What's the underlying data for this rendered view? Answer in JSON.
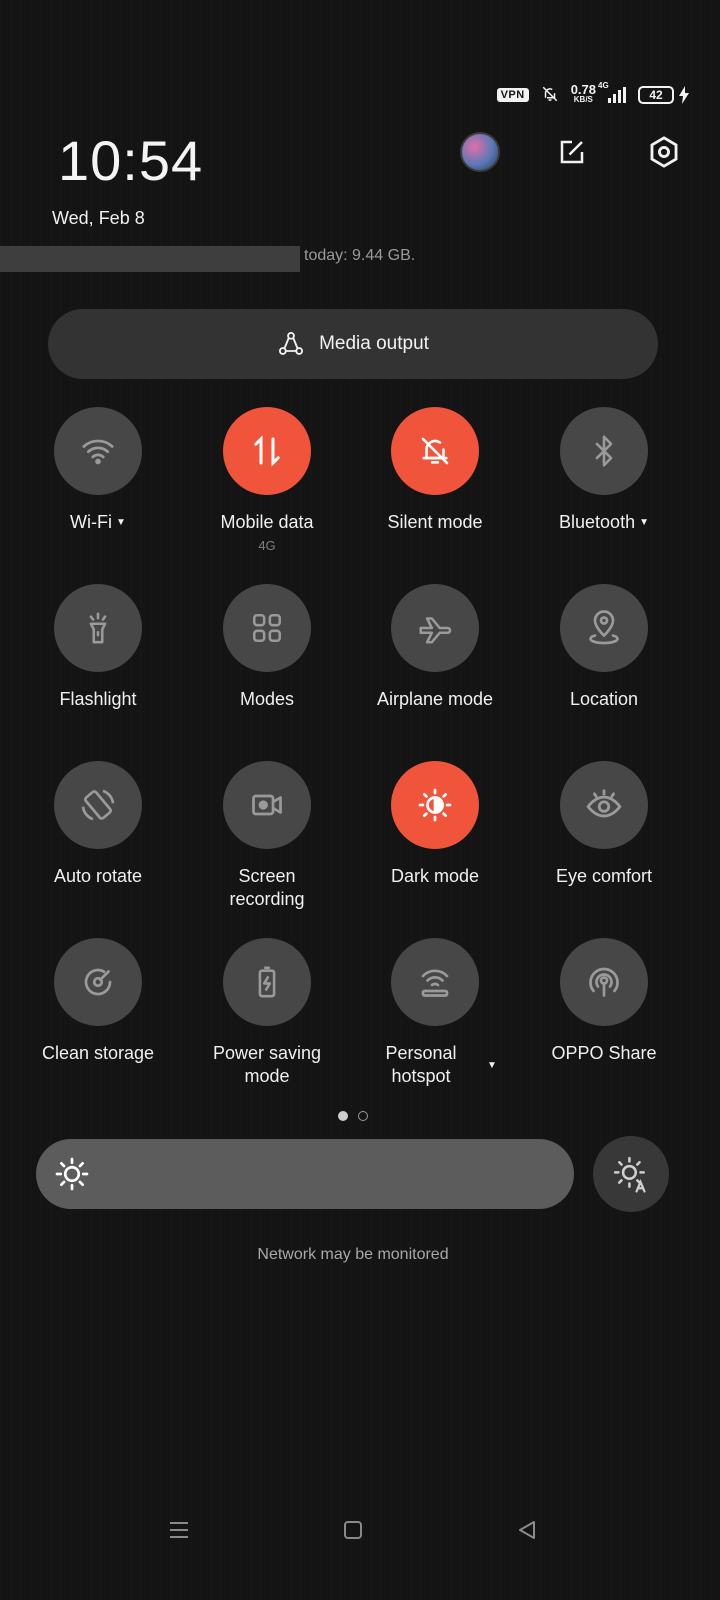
{
  "status_bar": {
    "vpn": "VPN",
    "speed_value": "0.78",
    "speed_unit": "KB/S",
    "network_type": "4G",
    "battery": "42",
    "icons": [
      "bell-off-icon",
      "signal-icon",
      "charging-icon"
    ]
  },
  "header": {
    "time": "10:54",
    "date": "Wed, Feb 8",
    "icons": [
      "avatar",
      "edit-icon",
      "settings-icon"
    ]
  },
  "usage": {
    "text": "today: 9.44 GB."
  },
  "media_output": {
    "label": "Media output",
    "icon": "media-output-icon"
  },
  "accent_color": "#f0553c",
  "tiles": [
    {
      "label": "Wi-Fi",
      "icon": "wifi-icon",
      "active": false,
      "has_menu": true
    },
    {
      "label": "Mobile data",
      "sub": "4G",
      "icon": "mobile-data-icon",
      "active": true
    },
    {
      "label": "Silent mode",
      "icon": "bell-off-icon",
      "active": true
    },
    {
      "label": "Bluetooth",
      "icon": "bluetooth-icon",
      "active": false,
      "has_menu": true
    },
    {
      "label": "Flashlight",
      "icon": "flashlight-icon",
      "active": false
    },
    {
      "label": "Modes",
      "icon": "modes-grid-icon",
      "active": false
    },
    {
      "label": "Airplane mode",
      "icon": "airplane-icon",
      "active": false
    },
    {
      "label": "Location",
      "icon": "location-icon",
      "active": false
    },
    {
      "label": "Auto rotate",
      "icon": "auto-rotate-icon",
      "active": false
    },
    {
      "label": "Screen recording",
      "icon": "screen-record-icon",
      "active": false
    },
    {
      "label": "Dark mode",
      "icon": "dark-mode-icon",
      "active": true
    },
    {
      "label": "Eye comfort",
      "icon": "eye-icon",
      "active": false
    },
    {
      "label": "Clean storage",
      "icon": "clean-storage-icon",
      "active": false
    },
    {
      "label": "Power saving mode",
      "icon": "battery-saver-icon",
      "active": false
    },
    {
      "label": "Personal hotspot",
      "icon": "hotspot-icon",
      "active": false,
      "has_menu": true
    },
    {
      "label": "OPPO Share",
      "icon": "oppo-share-icon",
      "active": false
    }
  ],
  "pager": {
    "pages": 2,
    "current": 1
  },
  "brightness": {
    "icon": "sun-icon",
    "auto_icon": "auto-brightness-icon"
  },
  "network_note": "Network may be monitored",
  "nav": [
    "menu-icon",
    "home-icon",
    "back-icon"
  ]
}
